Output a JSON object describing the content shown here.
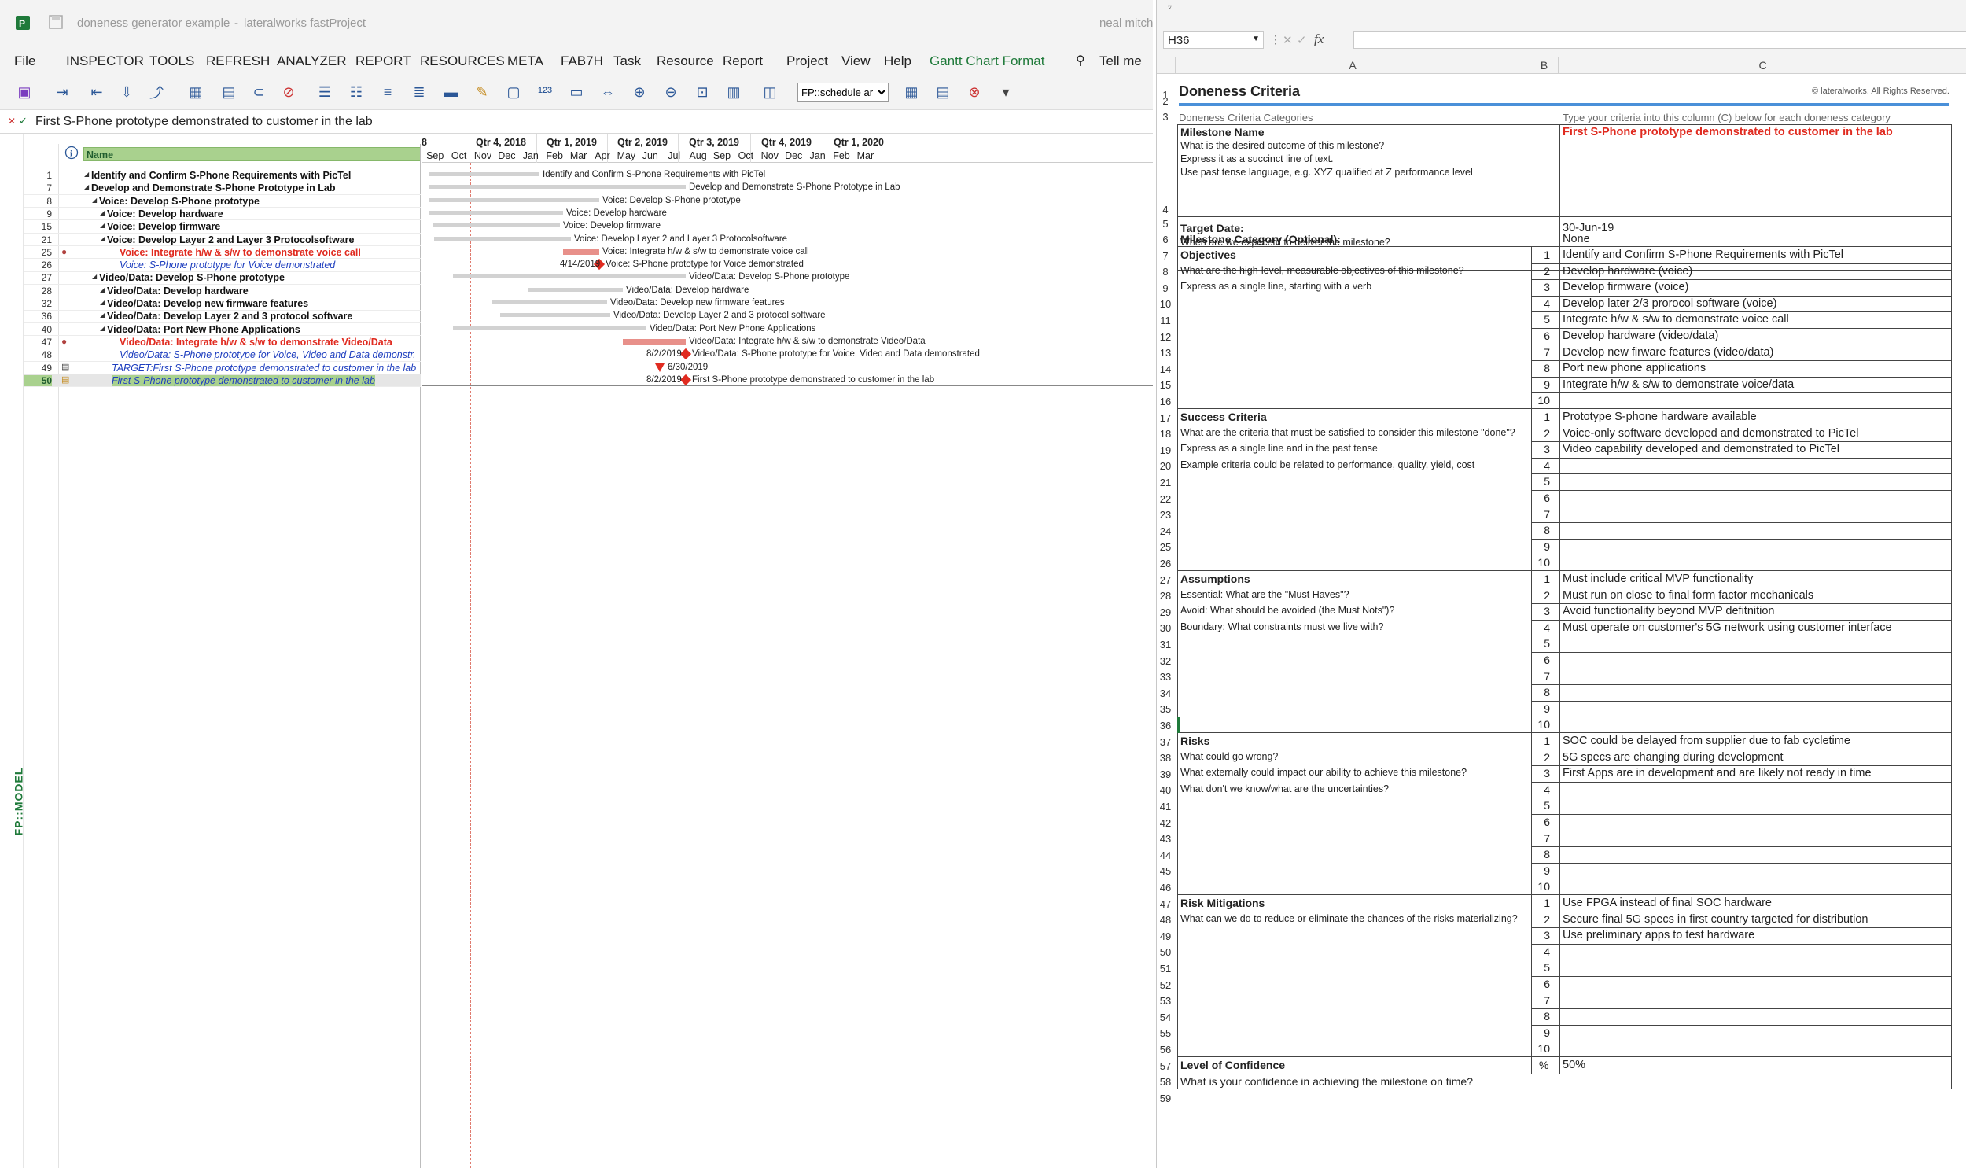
{
  "project": {
    "title": "doneness generator example",
    "separator": "-",
    "app": "lateralworks fastProject",
    "user": "neal mitch",
    "menu": [
      "File",
      "INSPECTOR",
      "TOOLS",
      "REFRESH",
      "ANALYZER",
      "REPORT",
      "RESOURCES",
      "META",
      "FAB7H",
      "Task",
      "Resource",
      "Report",
      "Project",
      "View",
      "Help",
      "Gantt Chart Format"
    ],
    "tell_me": "Tell me",
    "view_dropdown": "FP::schedule ar",
    "entry_text": "First S-Phone prototype demonstrated to customer in the lab",
    "side_label": "FP::MODEL",
    "grid_header": "Name",
    "timescale_top": [
      "8",
      "Qtr 4, 2018",
      "Qtr 1, 2019",
      "Qtr 2, 2019",
      "Qtr 3, 2019",
      "Qtr 4, 2019",
      "Qtr 1, 2020"
    ],
    "timescale_bottom": [
      "Sep",
      "Oct",
      "Nov",
      "Dec",
      "Jan",
      "Feb",
      "Mar",
      "Apr",
      "May",
      "Jun",
      "Jul",
      "Aug",
      "Sep",
      "Oct",
      "Nov",
      "Dec",
      "Jan",
      "Feb",
      "Mar"
    ],
    "tasks": [
      {
        "id": "1",
        "name": "Identify and Confirm S-Phone Requirements with PicTel",
        "style": "summary",
        "indent": 0,
        "bar_label": "Identify and Confirm S-Phone Requirements with PicTel"
      },
      {
        "id": "7",
        "name": "Develop and Demonstrate S-Phone Prototype in Lab",
        "style": "summary",
        "indent": 0,
        "bar_label": "Develop and Demonstrate S-Phone Prototype in Lab"
      },
      {
        "id": "8",
        "name": "Voice: Develop S-Phone prototype",
        "style": "summary",
        "indent": 1,
        "bar_label": "Voice: Develop S-Phone prototype"
      },
      {
        "id": "9",
        "name": "Voice: Develop hardware",
        "style": "summary",
        "indent": 2,
        "bar_label": "Voice: Develop hardware"
      },
      {
        "id": "15",
        "name": "Voice: Develop firmware",
        "style": "summary",
        "indent": 2,
        "bar_label": "Voice: Develop firmware"
      },
      {
        "id": "21",
        "name": "Voice: Develop Layer 2 and Layer 3 Protocolsoftware",
        "style": "summary",
        "indent": 2,
        "bar_label": "Voice: Develop Layer 2 and Layer 3 Protocolsoftware"
      },
      {
        "id": "25",
        "name": "Voice: Integrate h/w & s/w to demonstrate voice call",
        "style": "critical",
        "indent": 3,
        "bar_label": "Voice: Integrate h/w & s/w to demonstrate voice call"
      },
      {
        "id": "26",
        "name": "Voice: S-Phone prototype for Voice demonstrated",
        "style": "milestone",
        "indent": 3,
        "date": "4/14/2019",
        "bar_label": "Voice: S-Phone prototype for Voice demonstrated"
      },
      {
        "id": "27",
        "name": "Video/Data: Develop S-Phone prototype",
        "style": "summary",
        "indent": 1,
        "bar_label": "Video/Data: Develop S-Phone prototype"
      },
      {
        "id": "28",
        "name": "Video/Data: Develop hardware",
        "style": "summary",
        "indent": 2,
        "bar_label": "Video/Data: Develop hardware"
      },
      {
        "id": "32",
        "name": "Video/Data: Develop new firmware features",
        "style": "summary",
        "indent": 2,
        "bar_label": "Video/Data: Develop new firmware features"
      },
      {
        "id": "36",
        "name": "Video/Data: Develop Layer 2 and 3 protocol software",
        "style": "summary",
        "indent": 2,
        "bar_label": "Video/Data: Develop Layer 2 and 3 protocol software"
      },
      {
        "id": "40",
        "name": "Video/Data: Port New Phone Applications",
        "style": "summary",
        "indent": 2,
        "bar_label": "Video/Data: Port New Phone Applications"
      },
      {
        "id": "47",
        "name": "Video/Data: Integrate h/w & s/w to demonstrate Video/Data",
        "style": "critical",
        "indent": 3,
        "bar_label": "Video/Data: Integrate h/w & s/w to demonstrate Video/Data"
      },
      {
        "id": "48",
        "name": "Video/Data: S-Phone prototype for Voice, Video and Data demonstr.",
        "style": "milestone",
        "indent": 3,
        "date": "8/2/2019",
        "bar_label": "Video/Data: S-Phone prototype for Voice, Video and Data demonstrated"
      },
      {
        "id": "49",
        "name": "TARGET:First S-Phone prototype demonstrated to customer in the lab",
        "style": "target",
        "indent": 2,
        "date": "6/30/2019",
        "bar_label": ""
      },
      {
        "id": "50",
        "name": "First S-Phone prototype demonstrated to customer in the lab",
        "style": "selected",
        "indent": 2,
        "date": "8/2/2019",
        "bar_label": "First S-Phone prototype demonstrated to customer in the lab"
      }
    ]
  },
  "excel": {
    "name_box": "H36",
    "fx": "fx",
    "col_headers": [
      "A",
      "B",
      "C"
    ],
    "title": "Doneness Criteria",
    "copyright": "© lateralworks. All Rights Reserved.",
    "categories_label": "Doneness Criteria Categories",
    "instruction": "Type your criteria into this column (C) below for each doneness category",
    "milestone_name": {
      "label": "Milestone Name",
      "help": [
        "What is the desired outcome of this milestone?",
        "Express it as a succinct line of text.",
        "Use past tense language, e.g. XYZ qualified at Z performance level"
      ],
      "value": "First S-Phone prototype demonstrated to customer in the lab"
    },
    "target_date": {
      "label": "Target Date:",
      "help": "When are we expecetd to deliver the milestone?",
      "value": "30-Jun-19"
    },
    "milestone_category": {
      "label": "Milestone Category (Optional):",
      "value": "None"
    },
    "objectives": {
      "label": "Objectives",
      "help": [
        "What are the high-level, measurable objectives of this milestone?",
        "Express as a single line, starting with a verb"
      ],
      "items": [
        "Identify and Confirm S-Phone Requirements with PicTel",
        "Develop hardware (voice)",
        "Develop firmware (voice)",
        "Develop later 2/3 prorocol software (voice)",
        "Integrate h/w & s/w to demonstrate voice call",
        "Develop hardware (video/data)",
        "Develop new firware features (video/data)",
        "Port new phone applications",
        "Integrate h/w & s/w to demonstrate voice/data",
        ""
      ]
    },
    "success": {
      "label": "Success Criteria",
      "help": [
        "What are the criteria that must be satisfied to consider this milestone \"done\"?",
        "Express as a single line and in the past tense",
        "Example criteria could be related to performance, quality, yield, cost"
      ],
      "items": [
        "Prototype S-phone hardware available",
        "Voice-only software developed and demonstrated to PicTel",
        "Video capability developed and demonstrated to PicTel",
        "",
        "",
        "",
        "",
        "",
        "",
        ""
      ]
    },
    "assumptions": {
      "label": "Assumptions",
      "help": [
        "Essential: What are the \"Must Haves\"?",
        "Avoid: What should be avoided (the Must Nots\")?",
        "Boundary: What constraints must we live with?"
      ],
      "items": [
        "Must include critical MVP functionality",
        "Must run on close to final form factor mechanicals",
        "Avoid functionality beyond MVP defitnition",
        "Must operate on customer's 5G network using customer interface",
        "",
        "",
        "",
        "",
        "",
        ""
      ]
    },
    "risks": {
      "label": "Risks",
      "help": [
        "What could go wrong?",
        "What externally could impact our ability to achieve this milestone?",
        "What don't we know/what are the uncertainties?"
      ],
      "items": [
        "SOC could be delayed from supplier due to fab cycletime",
        "5G specs are changing during development",
        "First Apps are in development and are likely not ready in time",
        "",
        "",
        "",
        "",
        "",
        "",
        ""
      ]
    },
    "mitigations": {
      "label": "Risk Mitigations",
      "help": [
        "What can we do to reduce or eliminate the chances of the risks materializing?"
      ],
      "items": [
        "Use FPGA instead of final SOC hardware",
        "Secure final 5G specs in first country targeted for distribution",
        "Use preliminary apps to test hardware",
        "",
        "",
        "",
        "",
        "",
        "",
        ""
      ]
    },
    "confidence": {
      "label": "Level of Confidence",
      "help": "What is your confidence in achieving the milestone on time?",
      "unit": "%",
      "value": "50%"
    },
    "nums": [
      "1",
      "2",
      "3",
      "4",
      "5",
      "6",
      "7",
      "8",
      "9",
      "10"
    ]
  }
}
